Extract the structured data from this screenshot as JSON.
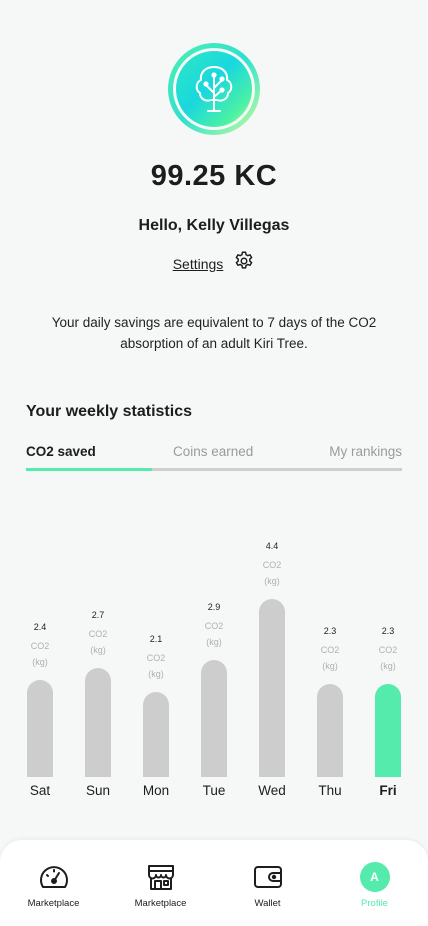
{
  "profile": {
    "avatar_icon": "tree-icon",
    "balance": "99.25 KC",
    "greeting": "Hello, Kelly Villegas",
    "settings_label": "Settings",
    "savings_text": "Your daily savings are equivalent to 7 days of the CO2 absorption of an adult Kiri Tree."
  },
  "stats": {
    "title": "Your weekly statistics",
    "tabs": [
      {
        "label": "CO2 saved",
        "active": true
      },
      {
        "label": "Coins earned",
        "active": false
      },
      {
        "label": "My rankings",
        "active": false
      }
    ]
  },
  "chart_data": {
    "type": "bar",
    "categories": [
      "Sat",
      "Sun",
      "Mon",
      "Tue",
      "Wed",
      "Thu",
      "Fri"
    ],
    "values": [
      2.4,
      2.7,
      2.1,
      2.9,
      4.4,
      2.3,
      2.3
    ],
    "unit_line1": "CO2",
    "unit_line2": "(kg)",
    "highlight": "Fri"
  },
  "nav": {
    "items": [
      {
        "label": "Marketplace",
        "icon": "speedometer-icon",
        "active": false
      },
      {
        "label": "Marketplace",
        "icon": "store-icon",
        "active": false
      },
      {
        "label": "Wallet",
        "icon": "wallet-icon",
        "active": false
      },
      {
        "label": "Profile",
        "icon": "profile-avatar",
        "avatar_letter": "A",
        "active": true
      }
    ]
  },
  "colors": {
    "accent": "#54ebad",
    "bar_inactive": "#cdcdcd",
    "background": "#f6f8f7"
  }
}
